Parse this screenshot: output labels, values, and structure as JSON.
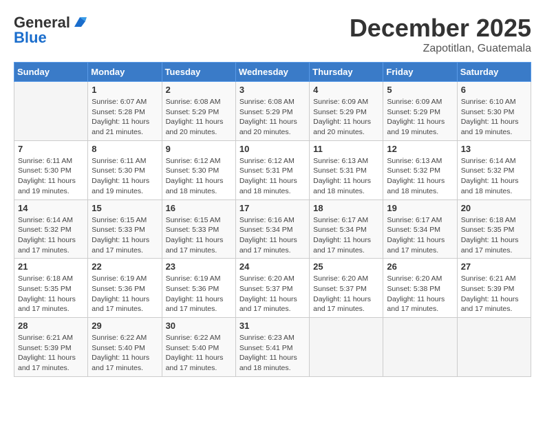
{
  "header": {
    "logo_general": "General",
    "logo_blue": "Blue",
    "title": "December 2025",
    "location": "Zapotitlan, Guatemala"
  },
  "calendar": {
    "days_of_week": [
      "Sunday",
      "Monday",
      "Tuesday",
      "Wednesday",
      "Thursday",
      "Friday",
      "Saturday"
    ],
    "weeks": [
      [
        {
          "day": "",
          "info": ""
        },
        {
          "day": "1",
          "info": "Sunrise: 6:07 AM\nSunset: 5:28 PM\nDaylight: 11 hours\nand 21 minutes."
        },
        {
          "day": "2",
          "info": "Sunrise: 6:08 AM\nSunset: 5:29 PM\nDaylight: 11 hours\nand 20 minutes."
        },
        {
          "day": "3",
          "info": "Sunrise: 6:08 AM\nSunset: 5:29 PM\nDaylight: 11 hours\nand 20 minutes."
        },
        {
          "day": "4",
          "info": "Sunrise: 6:09 AM\nSunset: 5:29 PM\nDaylight: 11 hours\nand 20 minutes."
        },
        {
          "day": "5",
          "info": "Sunrise: 6:09 AM\nSunset: 5:29 PM\nDaylight: 11 hours\nand 19 minutes."
        },
        {
          "day": "6",
          "info": "Sunrise: 6:10 AM\nSunset: 5:30 PM\nDaylight: 11 hours\nand 19 minutes."
        }
      ],
      [
        {
          "day": "7",
          "info": "Sunrise: 6:11 AM\nSunset: 5:30 PM\nDaylight: 11 hours\nand 19 minutes."
        },
        {
          "day": "8",
          "info": "Sunrise: 6:11 AM\nSunset: 5:30 PM\nDaylight: 11 hours\nand 19 minutes."
        },
        {
          "day": "9",
          "info": "Sunrise: 6:12 AM\nSunset: 5:30 PM\nDaylight: 11 hours\nand 18 minutes."
        },
        {
          "day": "10",
          "info": "Sunrise: 6:12 AM\nSunset: 5:31 PM\nDaylight: 11 hours\nand 18 minutes."
        },
        {
          "day": "11",
          "info": "Sunrise: 6:13 AM\nSunset: 5:31 PM\nDaylight: 11 hours\nand 18 minutes."
        },
        {
          "day": "12",
          "info": "Sunrise: 6:13 AM\nSunset: 5:32 PM\nDaylight: 11 hours\nand 18 minutes."
        },
        {
          "day": "13",
          "info": "Sunrise: 6:14 AM\nSunset: 5:32 PM\nDaylight: 11 hours\nand 18 minutes."
        }
      ],
      [
        {
          "day": "14",
          "info": "Sunrise: 6:14 AM\nSunset: 5:32 PM\nDaylight: 11 hours\nand 17 minutes."
        },
        {
          "day": "15",
          "info": "Sunrise: 6:15 AM\nSunset: 5:33 PM\nDaylight: 11 hours\nand 17 minutes."
        },
        {
          "day": "16",
          "info": "Sunrise: 6:15 AM\nSunset: 5:33 PM\nDaylight: 11 hours\nand 17 minutes."
        },
        {
          "day": "17",
          "info": "Sunrise: 6:16 AM\nSunset: 5:34 PM\nDaylight: 11 hours\nand 17 minutes."
        },
        {
          "day": "18",
          "info": "Sunrise: 6:17 AM\nSunset: 5:34 PM\nDaylight: 11 hours\nand 17 minutes."
        },
        {
          "day": "19",
          "info": "Sunrise: 6:17 AM\nSunset: 5:34 PM\nDaylight: 11 hours\nand 17 minutes."
        },
        {
          "day": "20",
          "info": "Sunrise: 6:18 AM\nSunset: 5:35 PM\nDaylight: 11 hours\nand 17 minutes."
        }
      ],
      [
        {
          "day": "21",
          "info": "Sunrise: 6:18 AM\nSunset: 5:35 PM\nDaylight: 11 hours\nand 17 minutes."
        },
        {
          "day": "22",
          "info": "Sunrise: 6:19 AM\nSunset: 5:36 PM\nDaylight: 11 hours\nand 17 minutes."
        },
        {
          "day": "23",
          "info": "Sunrise: 6:19 AM\nSunset: 5:36 PM\nDaylight: 11 hours\nand 17 minutes."
        },
        {
          "day": "24",
          "info": "Sunrise: 6:20 AM\nSunset: 5:37 PM\nDaylight: 11 hours\nand 17 minutes."
        },
        {
          "day": "25",
          "info": "Sunrise: 6:20 AM\nSunset: 5:37 PM\nDaylight: 11 hours\nand 17 minutes."
        },
        {
          "day": "26",
          "info": "Sunrise: 6:20 AM\nSunset: 5:38 PM\nDaylight: 11 hours\nand 17 minutes."
        },
        {
          "day": "27",
          "info": "Sunrise: 6:21 AM\nSunset: 5:39 PM\nDaylight: 11 hours\nand 17 minutes."
        }
      ],
      [
        {
          "day": "28",
          "info": "Sunrise: 6:21 AM\nSunset: 5:39 PM\nDaylight: 11 hours\nand 17 minutes."
        },
        {
          "day": "29",
          "info": "Sunrise: 6:22 AM\nSunset: 5:40 PM\nDaylight: 11 hours\nand 17 minutes."
        },
        {
          "day": "30",
          "info": "Sunrise: 6:22 AM\nSunset: 5:40 PM\nDaylight: 11 hours\nand 17 minutes."
        },
        {
          "day": "31",
          "info": "Sunrise: 6:23 AM\nSunset: 5:41 PM\nDaylight: 11 hours\nand 18 minutes."
        },
        {
          "day": "",
          "info": ""
        },
        {
          "day": "",
          "info": ""
        },
        {
          "day": "",
          "info": ""
        }
      ]
    ]
  }
}
